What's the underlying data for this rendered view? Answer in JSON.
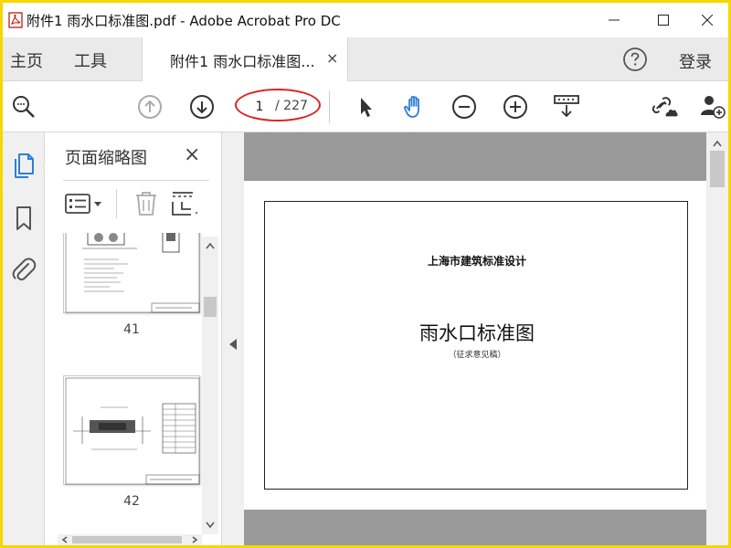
{
  "window": {
    "title": "附件1 雨水口标准图.pdf - Adobe Acrobat Pro DC",
    "controls": [
      "minimize",
      "maximize",
      "close"
    ]
  },
  "tabbar": {
    "home": "主页",
    "tools": "工具",
    "doc_tab": "附件1 雨水口标准图...",
    "close_tab": "×",
    "login": "登录"
  },
  "toolbar": {
    "current_page": "1",
    "total_pages": "/ 227",
    "icons": [
      "search-zoom-icon",
      "previous-page-icon",
      "next-page-icon",
      "select-cursor-icon",
      "hand-tool-icon",
      "zoom-out-icon",
      "zoom-in-icon",
      "scroll-mode-icon",
      "share-link-icon",
      "add-user-icon"
    ]
  },
  "sidebar": {
    "icons": [
      "page-thumbnails-icon",
      "bookmarks-icon",
      "attachments-icon"
    ]
  },
  "thumbnail_panel": {
    "title": "页面缩略图",
    "close": "×",
    "thumbnails": [
      {
        "page_label": "41"
      },
      {
        "page_label": "42"
      }
    ]
  },
  "document": {
    "org": "上海市建筑标准设计",
    "title": "雨水口标准图",
    "subtitle": "（征求意见稿）"
  },
  "colors": {
    "accent_blue": "#2d7fd6",
    "highlight_red": "#e02020",
    "outer_border": "#f5d800"
  }
}
